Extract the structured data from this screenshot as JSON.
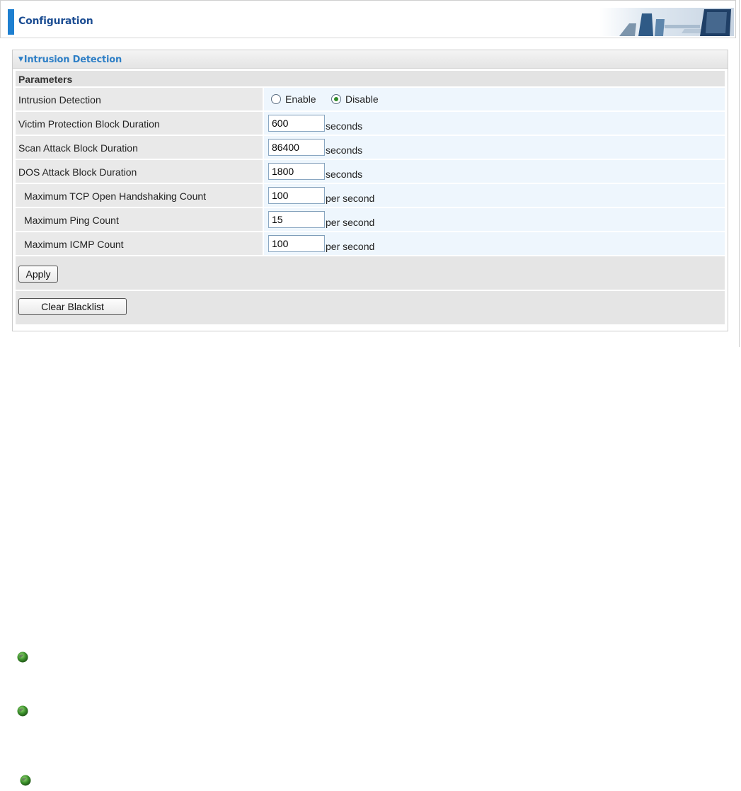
{
  "header": {
    "title": "Configuration"
  },
  "panel": {
    "title": "Intrusion Detection",
    "section_label": "Parameters",
    "intrusion_detection": {
      "label": "Intrusion Detection",
      "options": [
        "Enable",
        "Disable"
      ],
      "selected": "Disable"
    },
    "fields": [
      {
        "label": "Victim Protection Block Duration",
        "value": "600",
        "unit": "seconds"
      },
      {
        "label": "Scan Attack Block Duration",
        "value": "86400",
        "unit": "seconds"
      },
      {
        "label": "DOS Attack Block Duration",
        "value": "1800",
        "unit": "seconds"
      },
      {
        "label": "Maximum TCP Open Handshaking Count",
        "value": "100",
        "unit": "per second"
      },
      {
        "label": "Maximum Ping Count",
        "value": "15",
        "unit": "per second"
      },
      {
        "label": "Maximum ICMP Count",
        "value": "100",
        "unit": "per second"
      }
    ],
    "apply_label": "Apply",
    "clear_label": "Clear Blacklist"
  },
  "icons": {
    "header_art": "office-desk-banner-icon",
    "bullet": "green-globe-bullet-icon"
  },
  "colors": {
    "accent": "#1e7fd0",
    "header_title": "#1d4e93",
    "panel_title": "#2e7fc6",
    "value_cell_bg": "#eef6fd",
    "label_cell_bg": "#e9e9e9"
  }
}
